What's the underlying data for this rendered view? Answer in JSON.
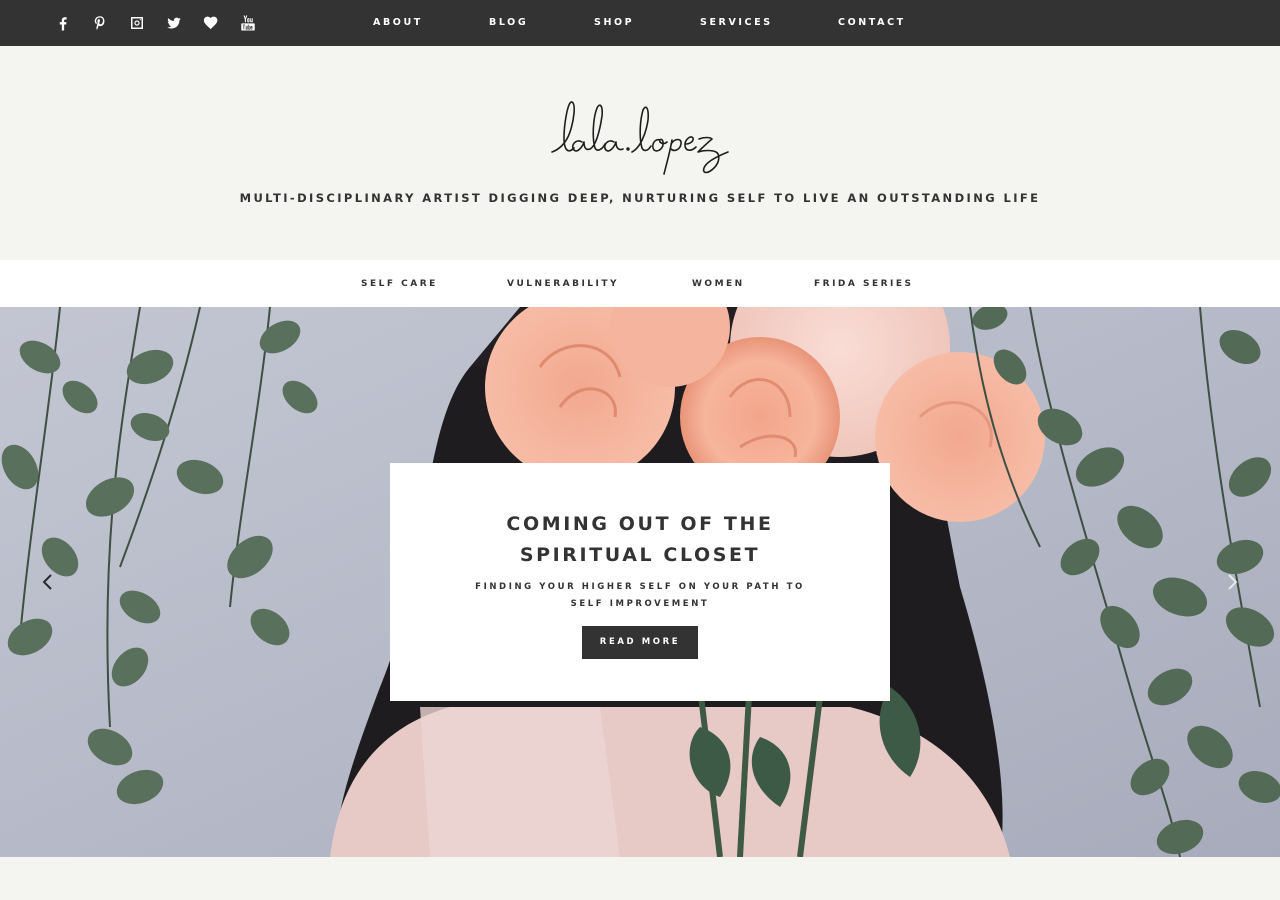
{
  "social_icons": [
    "facebook-icon",
    "pinterest-icon",
    "instagram-icon",
    "twitter-icon",
    "heart-icon",
    "youtube-icon"
  ],
  "top_nav": [
    "ABOUT",
    "BLOG",
    "SHOP",
    "SERVICES",
    "CONTACT"
  ],
  "logo_text": "lala lopez",
  "tagline": "MULTI-DISCIPLINARY ARTIST DIGGING DEEP, NURTURING SELF TO LIVE AN OUTSTANDING LIFE",
  "category_nav": [
    "SELF CARE",
    "VULNERABILITY",
    "WOMEN",
    "FRIDA SERIES"
  ],
  "hero": {
    "title_line1": "COMING OUT OF THE",
    "title_line2": "SPIRITUAL CLOSET",
    "subtitle_line1": "FINDING YOUR HIGHER SELF ON YOUR PATH TO",
    "subtitle_line2": "SELF IMPROVEMENT",
    "button": "READ MORE"
  },
  "colors": {
    "dark": "#333333",
    "background": "#f4f4f0",
    "white": "#ffffff"
  }
}
